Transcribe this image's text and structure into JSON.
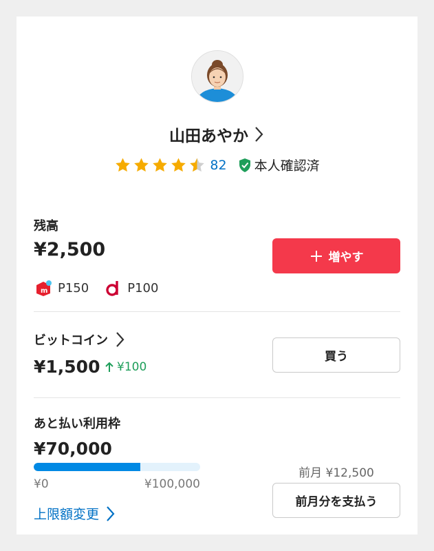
{
  "profile": {
    "name": "山田あやか",
    "rating_count": "82",
    "verified_label": "本人確認済",
    "stars": 4.5
  },
  "balance": {
    "label": "残高",
    "amount": "¥2,500",
    "add_button": "増やす",
    "points": [
      {
        "icon": "mercari-point-icon",
        "value": "P150"
      },
      {
        "icon": "d-point-icon",
        "value": "P100"
      }
    ]
  },
  "bitcoin": {
    "label": "ビットコイン",
    "amount": "¥1,500",
    "change": "¥100",
    "buy_button": "買う"
  },
  "deferred": {
    "label": "あと払い利用枠",
    "amount": "¥70,000",
    "progress": 0.64,
    "min_label": "¥0",
    "max_label": "¥100,000",
    "change_limit_link": "上限額変更",
    "prev_month_label": "前月 ¥12,500",
    "pay_button": "前月分を支払う"
  },
  "colors": {
    "accent_red": "#f4394b",
    "link_blue": "#0071c5",
    "up_green": "#1e9e5a",
    "star_gold": "#f6ab00"
  }
}
